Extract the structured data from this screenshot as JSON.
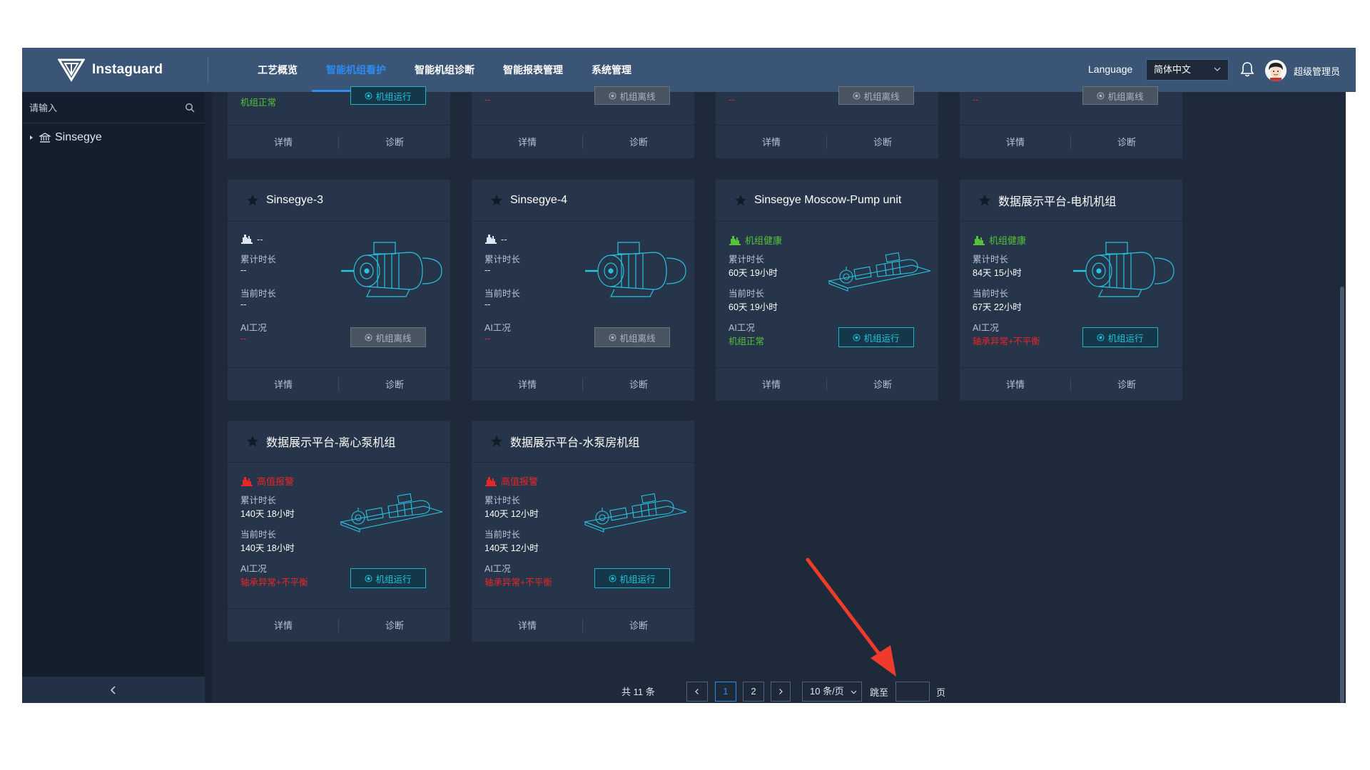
{
  "app": {
    "brand": "Instaguard",
    "nav": [
      {
        "label": "工艺概览",
        "active": false
      },
      {
        "label": "智能机组看护",
        "active": true
      },
      {
        "label": "智能机组诊断",
        "active": false
      },
      {
        "label": "智能报表管理",
        "active": false
      },
      {
        "label": "系统管理",
        "active": false
      }
    ],
    "language_label": "Language",
    "language_value": "简体中文",
    "user_name": "超级管理员"
  },
  "sidebar": {
    "search_placeholder": "请输入",
    "tree_root": "Sinsegye",
    "collapse_icon": "chevron-left-icon"
  },
  "labels": {
    "cumulative": "累计时长",
    "current": "当前时长",
    "ai": "AI工况",
    "detail": "详情",
    "diagnose": "诊断"
  },
  "top_cards": [
    {
      "value": "机组正常",
      "value_color": "green",
      "button": "机组运行",
      "button_state": "running"
    },
    {
      "value": "--",
      "value_color": "red",
      "button": "机组离线",
      "button_state": "offline"
    },
    {
      "value": "--",
      "value_color": "red",
      "button": "机组离线",
      "button_state": "offline"
    },
    {
      "value": "--",
      "value_color": "red",
      "button": "机组离线",
      "button_state": "offline"
    }
  ],
  "cards": [
    {
      "title": "Sinsegye-3",
      "status": "--",
      "status_color": "grey",
      "cumulative": "--",
      "current": "--",
      "ai": "--",
      "ai_color": "red",
      "button": "机组离线",
      "button_state": "offline",
      "image": "motor"
    },
    {
      "title": "Sinsegye-4",
      "status": "--",
      "status_color": "grey",
      "cumulative": "--",
      "current": "--",
      "ai": "--",
      "ai_color": "red",
      "button": "机组离线",
      "button_state": "offline",
      "image": "motor"
    },
    {
      "title": "Sinsegye Moscow-Pump unit",
      "status": "机组健康",
      "status_color": "green",
      "cumulative": "60天 19小时",
      "current": "60天 19小时",
      "ai": "机组正常",
      "ai_color": "green",
      "button": "机组运行",
      "button_state": "running",
      "image": "pump"
    },
    {
      "title": "数据展示平台-电机机组",
      "status": "机组健康",
      "status_color": "green",
      "cumulative": "84天 15小时",
      "current": "67天 22小时",
      "ai": "轴承异常+不平衡",
      "ai_color": "red",
      "button": "机组运行",
      "button_state": "running",
      "image": "motor"
    },
    {
      "title": "数据展示平台-离心泵机组",
      "status": "高值报警",
      "status_color": "red",
      "cumulative": "140天 18小时",
      "current": "140天 18小时",
      "ai": "轴承异常+不平衡",
      "ai_color": "red",
      "button": "机组运行",
      "button_state": "running",
      "image": "pump"
    },
    {
      "title": "数据展示平台-水泵房机组",
      "status": "高值报警",
      "status_color": "red",
      "cumulative": "140天 12小时",
      "current": "140天 12小时",
      "ai": "轴承异常+不平衡",
      "ai_color": "red",
      "button": "机组运行",
      "button_state": "running",
      "image": "pump"
    }
  ],
  "pagination": {
    "total": "共 11 条",
    "prev": "<",
    "pages": [
      "1",
      "2"
    ],
    "current_page": "1",
    "next": ">",
    "page_size": "10 条/页",
    "jump_label": "跳至",
    "jump_value": "",
    "page_suffix": "页"
  },
  "colors": {
    "header": "#3a5576",
    "content_bg": "#1e2939",
    "sidebar_bg": "#141e2d",
    "card_bg": "#263549",
    "accent": "#2d8cf0",
    "green": "#55c03a",
    "red": "#e8262a",
    "cyan": "#1fc3d6"
  }
}
